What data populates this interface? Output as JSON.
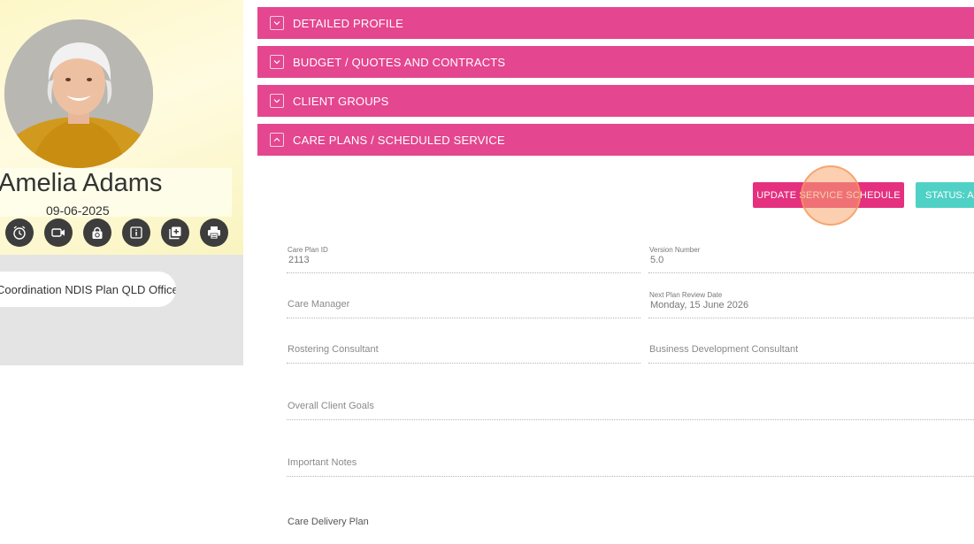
{
  "profile": {
    "name": "Amelia Adams",
    "date": "09-06-2025",
    "office": "Coordination NDIS Plan QLD Office",
    "action_icons": [
      "alarm-clock-icon",
      "video-camera-icon",
      "lock-refresh-icon",
      "info-icon",
      "add-copy-icon",
      "printer-icon"
    ]
  },
  "sections": [
    {
      "label": "DETAILED PROFILE",
      "state": "collapsed"
    },
    {
      "label": "BUDGET / QUOTES AND CONTRACTS",
      "state": "collapsed"
    },
    {
      "label": "CLIENT GROUPS",
      "state": "collapsed"
    },
    {
      "label": "CARE PLANS / SCHEDULED SERVICE",
      "state": "expanded"
    }
  ],
  "care_plan": {
    "update_button": "UPDATE SERVICE SCHEDULE",
    "status_button": "STATUS: AC",
    "fields": {
      "care_plan_id": {
        "label": "Care Plan ID",
        "value": "2113"
      },
      "version_number": {
        "label": "Version Number",
        "value": "5.0"
      },
      "care_manager": {
        "label": "Care Manager"
      },
      "next_review": {
        "label": "Next Plan Review Date",
        "value": "Monday, 15 June 2026"
      },
      "rostering_consultant": {
        "label": "Rostering Consultant"
      },
      "bd_consultant": {
        "label": "Business Development Consultant"
      },
      "client_goals": {
        "label": "Overall Client Goals"
      },
      "important_notes": {
        "label": "Important Notes"
      },
      "care_delivery_plan": {
        "label": "Care Delivery Plan"
      }
    }
  },
  "colors": {
    "section_bar": "#e4468f",
    "update_button": "#e4307f",
    "status_button": "#4fd1c5",
    "profile_bg": "#fdf7c8",
    "click_marker": "#f7a870"
  }
}
